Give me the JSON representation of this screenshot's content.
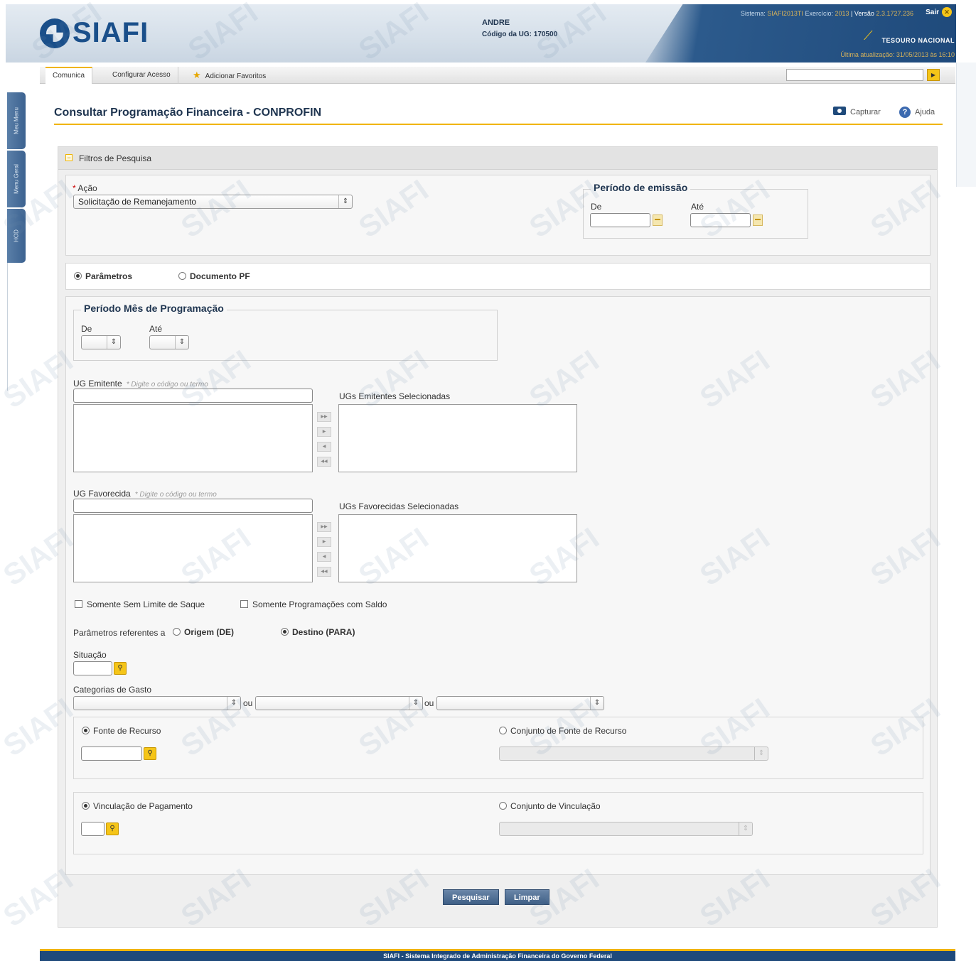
{
  "header": {
    "logo_text": "SIAFI",
    "user": "ANDRE",
    "ug_label": "Código da UG:",
    "ug_code": "170500",
    "sistema_label": "Sistema:",
    "sistema_value": "SIAFI2013TI",
    "exercicio_label": "Exercício:",
    "exercicio_value": "2013",
    "versao_label": "Versão",
    "versao_value": "2.3.1727.236",
    "sair": "Sair",
    "tesouro": "TESOURO NACIONAL",
    "update_label": "Última atualização: 31/05/2013 às 16:10"
  },
  "menu": {
    "items": [
      "Comunica",
      "Configurar Acesso",
      "Adicionar Favoritos"
    ]
  },
  "sidebar": {
    "tabs": [
      "Meu Menu",
      "Menu Geral",
      "HOD"
    ]
  },
  "page": {
    "title": "Consultar Programação Financeira - CONPROFIN",
    "capturar": "Capturar",
    "ajuda": "Ajuda"
  },
  "filters": {
    "header": "Filtros de Pesquisa",
    "acao_label": "Ação",
    "acao_value": "Solicitação de Remanejamento",
    "periodo_emissao": "Período de emissão",
    "de": "De",
    "ate": "Até",
    "radio_parametros": "Parâmetros",
    "radio_documento": "Documento PF",
    "periodo_mes": "Período Mês de Programação",
    "ug_emitente": "UG Emitente",
    "hint": "* Digite o código ou termo",
    "ugs_emitentes_sel": "UGs Emitentes Selecionadas",
    "ug_favorecida": "UG Favorecida",
    "ugs_favorecidas_sel": "UGs Favorecidas Selecionadas",
    "chk_sem_limite": "Somente Sem Limite de Saque",
    "chk_com_saldo": "Somente Programações com Saldo",
    "param_ref": "Parâmetros referentes a",
    "origem": "Origem (DE)",
    "destino": "Destino (PARA)",
    "situacao": "Situação",
    "categorias": "Categorias de Gasto",
    "ou": "ou",
    "fonte_recurso": "Fonte de Recurso",
    "conj_fonte": "Conjunto de Fonte de Recurso",
    "vinc_pag": "Vinculação de Pagamento",
    "conj_vinc": "Conjunto de Vinculação"
  },
  "buttons": {
    "pesquisar": "Pesquisar",
    "limpar": "Limpar"
  },
  "footer": "SIAFI - Sistema Integrado de Administração Financeira do Governo Federal",
  "watermark": "SIAFI",
  "colors": {
    "brand": "#1f4a7b",
    "accent": "#f0b400"
  }
}
